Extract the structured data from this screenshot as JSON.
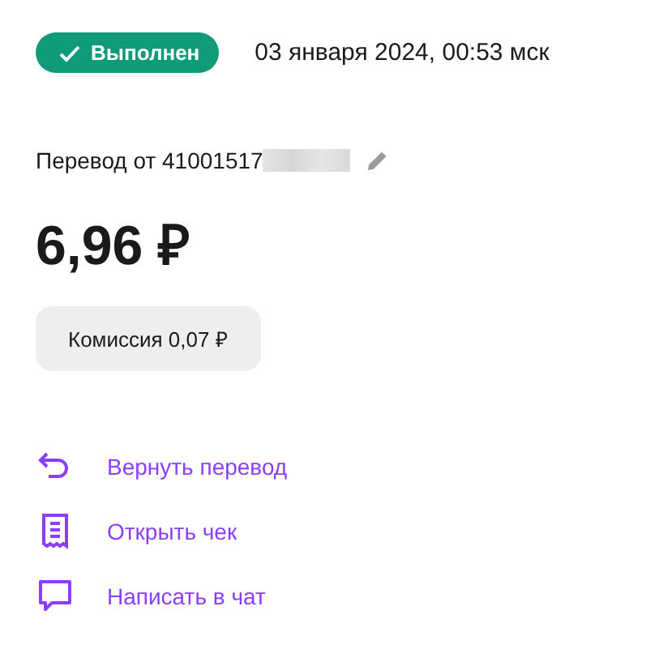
{
  "status": {
    "label": "Выполнен",
    "kind": "done"
  },
  "date": "03 января 2024, 00:53 мск",
  "title": "Перевод от 41001517",
  "amount": "6,96 ₽",
  "commission": "Комиссия 0,07 ₽",
  "actions": [
    {
      "kind": "return",
      "label": "Вернуть перевод"
    },
    {
      "kind": "receipt",
      "label": "Открыть чек"
    },
    {
      "kind": "chat",
      "label": "Написать в чат"
    }
  ]
}
